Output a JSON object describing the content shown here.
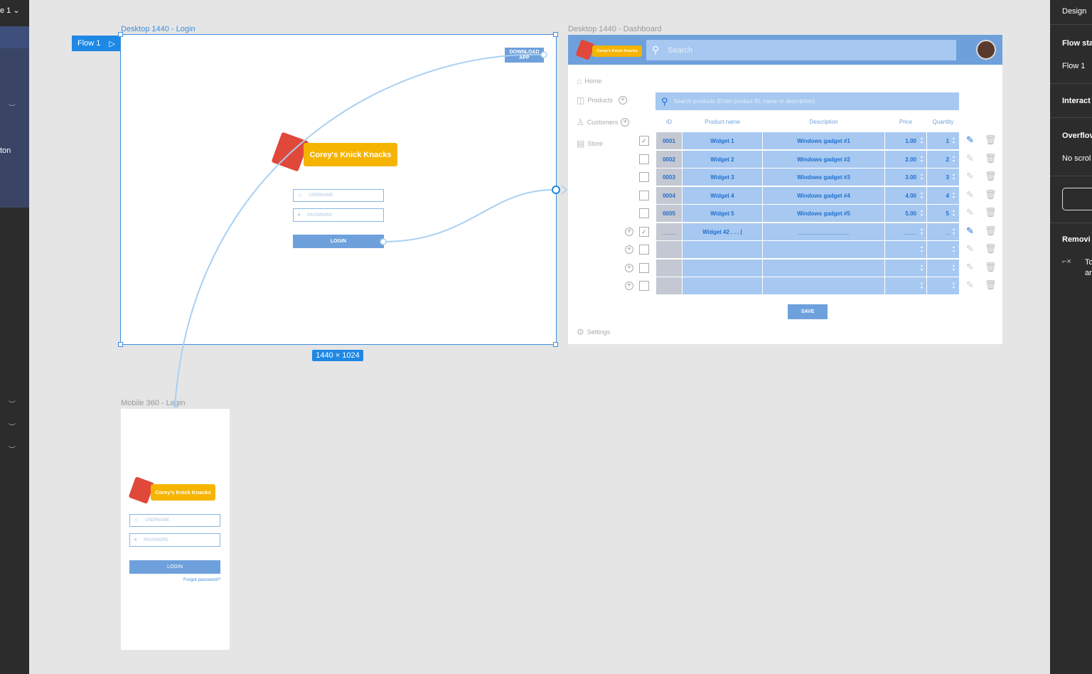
{
  "left_panel": {
    "page_label": "e 1",
    "page_chevron": "⌄",
    "item_label": "ton",
    "eye_glyph": "︶"
  },
  "right_panel": {
    "tab": "Design",
    "flow_start_label": "Flow sta",
    "flow_name": "Flow 1",
    "interactions_label": "Interact",
    "overflow_label": "Overflov",
    "overflow_value": "No scrol",
    "removing_label": "Removi",
    "removing_text_1": "To",
    "removing_text_2": "ar"
  },
  "flow_badge": {
    "label": "Flow 1",
    "play_icon": "▷"
  },
  "dimension_badge": "1440 × 1024",
  "frames": {
    "login": {
      "name": "Desktop 1440 - Login",
      "download_button": "DOWNLOAD APP",
      "logo_text": "Corey's Knick Knacks",
      "username_placeholder": "USERNAME",
      "password_placeholder": "PASSWORD",
      "login_button": "LOGIN"
    },
    "dashboard": {
      "name": "Desktop 1440 - Dashboard",
      "logo_text": "Corey's Knick Knacks",
      "search_placeholder": "Search",
      "nav": [
        {
          "label": "Home",
          "icon": "home-icon"
        },
        {
          "label": "Products",
          "icon": "box-icon"
        },
        {
          "label": "Customers",
          "icon": "user-icon"
        },
        {
          "label": "Store",
          "icon": "store-icon"
        },
        {
          "label": "Settings",
          "icon": "gear-icon"
        }
      ],
      "product_search_placeholder": "Search products (Enter product ID, name or description)",
      "columns": [
        "ID",
        "Product name",
        "Description",
        "Price",
        "Quantity"
      ],
      "rows": [
        {
          "id": "0001",
          "name": "Widget 1",
          "description": "Windows gadget #1",
          "price": "1.00",
          "quantity": "1",
          "checked": true,
          "editing": true
        },
        {
          "id": "0002",
          "name": "Widget 2",
          "description": "Windows gadget #2",
          "price": "2.00",
          "quantity": "2",
          "checked": false,
          "editing": false
        },
        {
          "id": "0003",
          "name": "Widget 3",
          "description": "Windows gadget #3",
          "price": "3.00",
          "quantity": "3",
          "checked": false,
          "editing": false
        },
        {
          "id": "0004",
          "name": "Widget 4",
          "description": "Windows gadget #4",
          "price": "4.00",
          "quantity": "4",
          "checked": false,
          "editing": false
        },
        {
          "id": "0005",
          "name": "Widget 5",
          "description": "Windows gadget #5",
          "price": "5.00",
          "quantity": "5",
          "checked": false,
          "editing": false
        },
        {
          "id": "____",
          "name": "Widget 42 . . . |",
          "description": "________________",
          "price": "____",
          "quantity": "_",
          "checked": true,
          "editing": true,
          "add": true
        },
        {
          "id": "",
          "name": "",
          "description": "",
          "price": "",
          "quantity": "",
          "checked": false,
          "editing": false,
          "add": true
        },
        {
          "id": "",
          "name": "",
          "description": "",
          "price": "",
          "quantity": "",
          "checked": false,
          "editing": false,
          "add": true
        },
        {
          "id": "",
          "name": "",
          "description": "",
          "price": "",
          "quantity": "",
          "checked": false,
          "editing": false,
          "add": true
        }
      ],
      "save_button": "SAVE"
    },
    "mobile": {
      "name": "Mobile 360 - Login",
      "logo_text": "Corey's Knick Knacks",
      "username_placeholder": "USERNAME",
      "password_placeholder": "PASSWORD",
      "login_button": "LOGIN",
      "forgot_link": "Forgot password?"
    }
  },
  "colors": {
    "accent": "#1e88e5",
    "frame_blue": "#6ea0dc",
    "light_blue": "#a7c8f0",
    "logo_yellow": "#f5b400",
    "logo_red": "#e0483a"
  }
}
